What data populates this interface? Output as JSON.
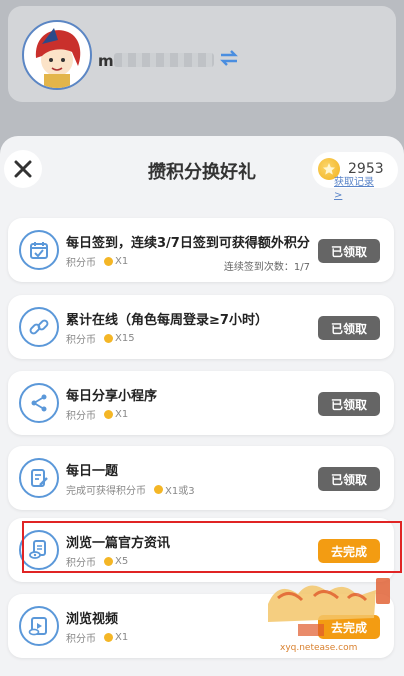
{
  "profile": {
    "username_initial": "m"
  },
  "sheet": {
    "title": "攒积分换好礼",
    "points": "2953",
    "record_link": "获取记录>"
  },
  "tasks": [
    {
      "name": "每日签到，连续3/7日签到可获得额外积分",
      "sub": "积分币",
      "reward": "X1",
      "extra": "连续签到次数：1/7",
      "button": "已领取",
      "icon": "calendar-check-icon"
    },
    {
      "name": "累计在线（角色每周登录≥7小时）",
      "sub": "积分币",
      "reward": "X15",
      "button": "已领取",
      "icon": "link-icon"
    },
    {
      "name": "每日分享小程序",
      "sub": "积分币",
      "reward": "X1",
      "button": "已领取",
      "icon": "share-icon"
    },
    {
      "name": "每日一题",
      "sub": "完成可获得积分币",
      "reward": "X1或3",
      "button": "已领取",
      "icon": "quiz-edit-icon"
    },
    {
      "name": "浏览一篇官方资讯",
      "sub": "积分币",
      "reward": "X5",
      "button": "去完成",
      "icon": "document-eye-icon"
    },
    {
      "name": "浏览视频",
      "sub": "积分币",
      "reward": "X1",
      "button": "去完成",
      "icon": "video-icon"
    }
  ],
  "watermark": {
    "text": "xyq.netease.com"
  },
  "colors": {
    "accent_blue": "#5b98d9",
    "done_button": "#656565",
    "todo_button": "#f39c12",
    "highlight": "#e02424"
  }
}
